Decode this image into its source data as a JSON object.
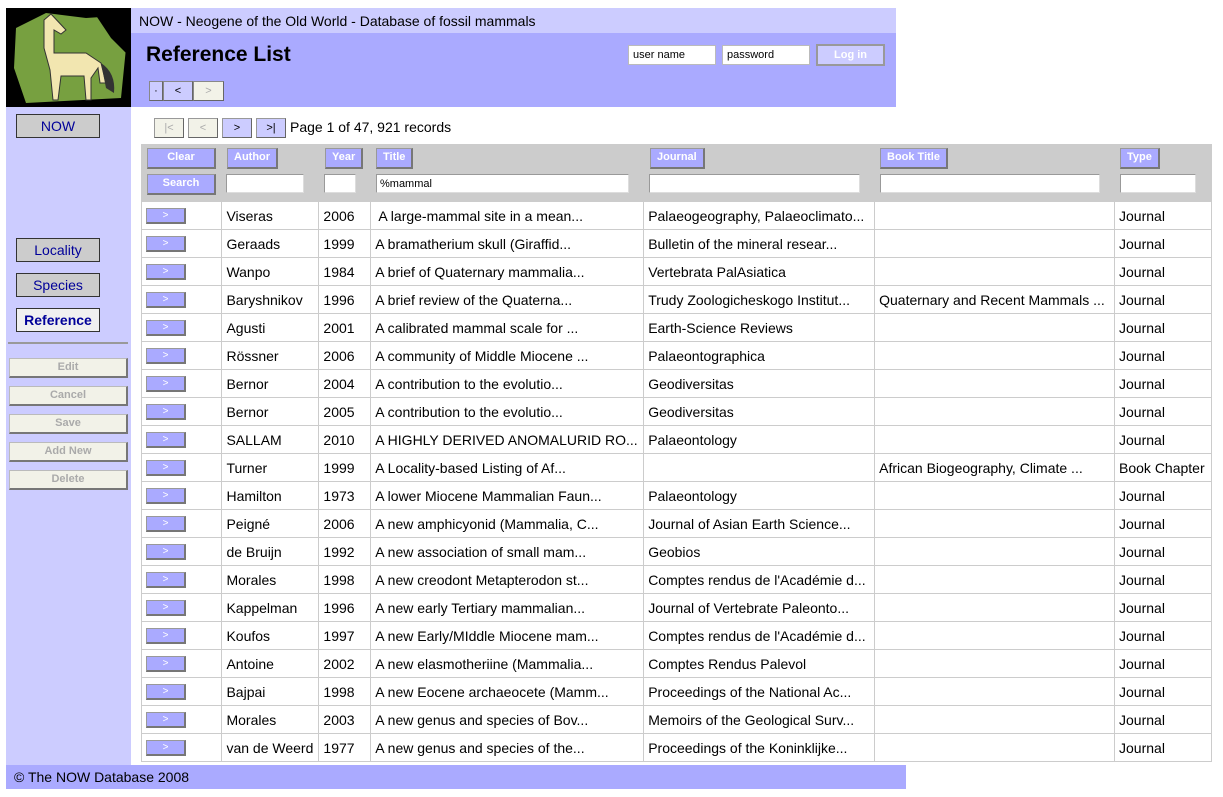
{
  "app_title": "NOW - Neogene of the Old World - Database of fossil mammals",
  "page_title": "Reference List",
  "history_nav": {
    "dot": "·",
    "back": "<",
    "forward": ">"
  },
  "login": {
    "username": "user name",
    "password": "password",
    "button": "Log in"
  },
  "sidebar": {
    "nav": [
      {
        "label": "NOW"
      },
      {
        "label": "Locality"
      },
      {
        "label": "Species"
      },
      {
        "label": "Reference",
        "active": true
      }
    ],
    "actions": [
      "Edit",
      "Cancel",
      "Save",
      "Add New",
      "Delete"
    ]
  },
  "pagination": {
    "first": "|<",
    "prev": "<",
    "next": ">",
    "last": ">|",
    "info": "Page 1 of 47, 921 records"
  },
  "filter": {
    "clear": "Clear",
    "search": "Search",
    "columns": [
      {
        "label": "Author",
        "value": ""
      },
      {
        "label": "Year",
        "value": ""
      },
      {
        "label": "Title",
        "value": "%mammal"
      },
      {
        "label": "Journal",
        "value": ""
      },
      {
        "label": "Book Title",
        "value": ""
      },
      {
        "label": "Type",
        "value": ""
      }
    ]
  },
  "row_button": ">",
  "rows": [
    {
      "author": "Viseras",
      "year": "2006",
      "title": " A large-mammal site in a mean...",
      "journal": "Palaeogeography, Palaeoclimato...",
      "book": "",
      "type": "Journal"
    },
    {
      "author": "Geraads",
      "year": "1999",
      "title": "A bramatherium skull (Giraffid...",
      "journal": "Bulletin of the mineral resear...",
      "book": "",
      "type": "Journal"
    },
    {
      "author": "Wanpo",
      "year": "1984",
      "title": "A brief of Quaternary mammalia...",
      "journal": "Vertebrata PalAsiatica",
      "book": "",
      "type": "Journal"
    },
    {
      "author": "Baryshnikov",
      "year": "1996",
      "title": "A brief review of the Quaterna...",
      "journal": "Trudy Zoologicheskogo Institut...",
      "book": "Quaternary and Recent Mammals ...",
      "type": "Journal"
    },
    {
      "author": "Agusti",
      "year": "2001",
      "title": "A calibrated mammal scale for ...",
      "journal": "Earth-Science Reviews",
      "book": "",
      "type": "Journal"
    },
    {
      "author": "Rössner",
      "year": "2006",
      "title": "A community of Middle Miocene ...",
      "journal": "Palaeontographica",
      "book": "",
      "type": "Journal"
    },
    {
      "author": "Bernor",
      "year": "2004",
      "title": "A contribution to the evolutio...",
      "journal": "Geodiversitas",
      "book": "",
      "type": "Journal"
    },
    {
      "author": "Bernor",
      "year": "2005",
      "title": "A contribution to the evolutio...",
      "journal": "Geodiversitas",
      "book": "",
      "type": "Journal"
    },
    {
      "author": "SALLAM",
      "year": "2010",
      "title": "A HIGHLY DERIVED ANOMALURID RO...",
      "journal": "Palaeontology",
      "book": "",
      "type": "Journal"
    },
    {
      "author": "Turner",
      "year": "1999",
      "title": "A Locality-based Listing of Af...",
      "journal": "",
      "book": "African Biogeography, Climate ...",
      "type": "Book Chapter"
    },
    {
      "author": "Hamilton",
      "year": "1973",
      "title": "A lower Miocene Mammalian Faun...",
      "journal": "Palaeontology",
      "book": "",
      "type": "Journal"
    },
    {
      "author": "Peigné",
      "year": "2006",
      "title": "A new amphicyonid (Mammalia, C...",
      "journal": "Journal of Asian Earth Science...",
      "book": "",
      "type": "Journal"
    },
    {
      "author": "de Bruijn",
      "year": "1992",
      "title": "A new association of small mam...",
      "journal": "Geobios",
      "book": "",
      "type": "Journal"
    },
    {
      "author": "Morales",
      "year": "1998",
      "title": "A new creodont Metapterodon st...",
      "journal": "Comptes rendus de l'Académie d...",
      "book": "",
      "type": "Journal"
    },
    {
      "author": "Kappelman",
      "year": "1996",
      "title": "A new early Tertiary mammalian...",
      "journal": "Journal of Vertebrate Paleonto...",
      "book": "",
      "type": "Journal"
    },
    {
      "author": "Koufos",
      "year": "1997",
      "title": "A new Early/MIddle Miocene mam...",
      "journal": "Comptes rendus de l'Académie d...",
      "book": "",
      "type": "Journal"
    },
    {
      "author": "Antoine",
      "year": "2002",
      "title": "A new elasmotheriine (Mammalia...",
      "journal": "Comptes Rendus Palevol",
      "book": "",
      "type": "Journal"
    },
    {
      "author": "Bajpai",
      "year": "1998",
      "title": "A new Eocene archaeocete (Mamm...",
      "journal": "Proceedings of the National Ac...",
      "book": "",
      "type": "Journal"
    },
    {
      "author": "Morales",
      "year": "2003",
      "title": "A new genus and species of Bov...",
      "journal": "Memoirs of the Geological Surv...",
      "book": "",
      "type": "Journal"
    },
    {
      "author": "van de Weerd",
      "year": "1977",
      "title": "A new genus and species of the...",
      "journal": "Proceedings of the Koninklijke...",
      "book": "",
      "type": "Journal"
    }
  ],
  "footer": "© The NOW Database 2008",
  "colors": {
    "light_purple": "#ccccff",
    "purple": "#aaaaff",
    "gray": "#cccccc"
  }
}
